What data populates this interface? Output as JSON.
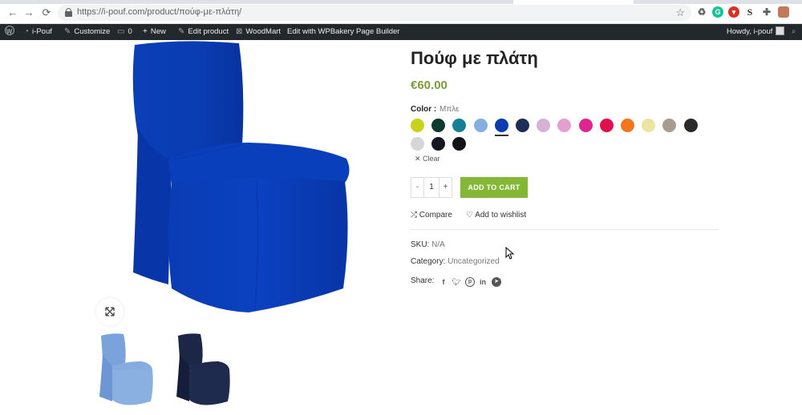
{
  "browser": {
    "url": "https://i-pouf.com/product/πούφ-με-πλάτη/",
    "nav": {
      "back": "←",
      "forward": "→",
      "reload": "⟳"
    }
  },
  "adminbar": {
    "site_name": "i-Pouf",
    "customize": "Customize",
    "comments_count": "0",
    "new": "New",
    "edit_product": "Edit product",
    "woodmart": "WoodMart",
    "wpbakery": "Edit with WPBakery Page Builder",
    "howdy": "Howdy, i-pouf"
  },
  "product": {
    "title": "Πούφ με πλάτη",
    "price": "€60.00",
    "color_label": "Color :",
    "color_value": "Μπλε",
    "clear": "Clear",
    "quantity": "1",
    "qty_minus": "-",
    "qty_plus": "+",
    "add_to_cart": "ADD TO CART",
    "compare": "Compare",
    "wishlist": "Add to wishlist",
    "sku_label": "SKU:",
    "sku_value": "N/A",
    "category_label": "Category:",
    "category_value": "Uncategorized",
    "share_label": "Share:"
  },
  "swatches": [
    {
      "color": "#c6d31a",
      "name": "lime"
    },
    {
      "color": "#0d3b30",
      "name": "dark-green"
    },
    {
      "color": "#147f97",
      "name": "teal"
    },
    {
      "color": "#87aee0",
      "name": "light-blue"
    },
    {
      "color": "#0a3cb0",
      "name": "blue",
      "selected": true
    },
    {
      "color": "#1e2d55",
      "name": "navy"
    },
    {
      "color": "#d6b2d6",
      "name": "lilac"
    },
    {
      "color": "#e39fd0",
      "name": "pink"
    },
    {
      "color": "#dc2591",
      "name": "magenta"
    },
    {
      "color": "#e0104f",
      "name": "red"
    },
    {
      "color": "#f3761d",
      "name": "orange"
    },
    {
      "color": "#ece5a2",
      "name": "cream"
    },
    {
      "color": "#a89b90",
      "name": "taupe"
    },
    {
      "color": "#2b2a28",
      "name": "charcoal"
    },
    {
      "color": "#d4d6d8",
      "name": "light-grey"
    },
    {
      "color": "#141820",
      "name": "black-1"
    },
    {
      "color": "#121418",
      "name": "black-2"
    }
  ],
  "colors": {
    "accent_green": "#83b735",
    "price_green": "#7a9c3f",
    "adminbar_bg": "#23282d",
    "product_blue": "#0a3cb4"
  }
}
